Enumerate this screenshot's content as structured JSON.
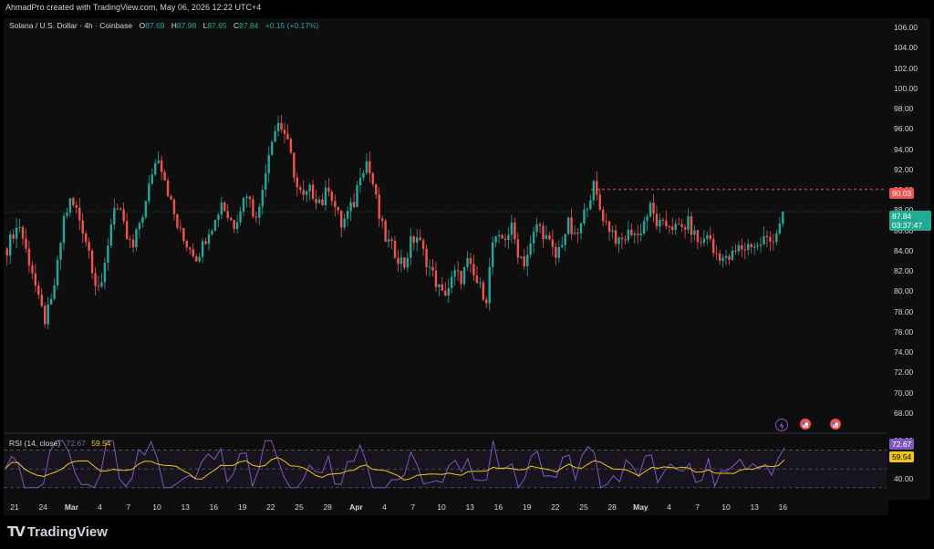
{
  "credit": "AhmadPro created with TradingView.com, May 06, 2026 12:22 UTC+4",
  "legend": {
    "symbol": "Solana / U.S. Dollar · 4h · Coinbase",
    "o_label": "O",
    "o_value": "87.69",
    "h_label": "H",
    "h_value": "87.98",
    "l_label": "L",
    "l_value": "87.65",
    "c_label": "C",
    "c_value": "87.84",
    "change": "+0.15 (+0.17%)"
  },
  "rsi_legend": {
    "label": "RSI (14, close)",
    "rsi": "72.67",
    "ma": "59.54"
  },
  "tags": {
    "level": "90.03",
    "price": "87.84",
    "countdown": "03:37:47",
    "rsi": "72.67",
    "rsi_ma": "59.54"
  },
  "brand": {
    "text": "TradingView",
    "mark": "TV"
  },
  "colors": {
    "up": "#26a69a",
    "down": "#ef5350",
    "rsi": "#7e57c2",
    "rsi_ma": "#f0c419",
    "level": "#ef5350",
    "bg": "#0e0e0e"
  },
  "icons": [
    "lightning-event-icon",
    "us-flag-event-icon",
    "us-flag-event-icon"
  ],
  "chart_data": {
    "type": "candlestick",
    "timeframe": "4h",
    "y_ticks": [
      "106.00",
      "104.00",
      "102.00",
      "100.00",
      "98.00",
      "96.00",
      "94.00",
      "92.00",
      "90.00",
      "88.00",
      "86.00",
      "84.00",
      "82.00",
      "80.00",
      "78.00",
      "76.00",
      "74.00",
      "72.00",
      "70.00",
      "68.00"
    ],
    "ylim": [
      67,
      106
    ],
    "x_ticks": [
      {
        "label": "21"
      },
      {
        "label": "24"
      },
      {
        "label": "Mar",
        "bold": true
      },
      {
        "label": "4"
      },
      {
        "label": "7"
      },
      {
        "label": "10"
      },
      {
        "label": "13"
      },
      {
        "label": "16"
      },
      {
        "label": "19"
      },
      {
        "label": "22"
      },
      {
        "label": "25"
      },
      {
        "label": "28"
      },
      {
        "label": "Apr",
        "bold": true
      },
      {
        "label": "4"
      },
      {
        "label": "7"
      },
      {
        "label": "10"
      },
      {
        "label": "13"
      },
      {
        "label": "16"
      },
      {
        "label": "19"
      },
      {
        "label": "22"
      },
      {
        "label": "25"
      },
      {
        "label": "28"
      },
      {
        "label": "May",
        "bold": true
      },
      {
        "label": "4"
      },
      {
        "label": "7"
      },
      {
        "label": "10"
      },
      {
        "label": "13"
      },
      {
        "label": "16"
      }
    ],
    "horizontal_level": 90.03,
    "last_price": 87.84,
    "closes": [
      84.2,
      85.8,
      86.5,
      84.0,
      82.0,
      79.0,
      77.2,
      78.8,
      82.5,
      87.2,
      88.8,
      88.0,
      86.2,
      84.0,
      81.0,
      80.2,
      84.8,
      88.6,
      87.4,
      85.2,
      84.2,
      86.8,
      88.6,
      91.8,
      93.4,
      91.2,
      88.6,
      86.4,
      85.0,
      84.4,
      83.4,
      84.5,
      86.2,
      86.9,
      88.9,
      87.4,
      86.6,
      88.3,
      89.8,
      87.8,
      88.0,
      92.2,
      95.3,
      96.6,
      95.6,
      93.2,
      90.2,
      89.1,
      89.9,
      89.3,
      88.8,
      90.4,
      88.3,
      86.5,
      87.6,
      88.7,
      91.8,
      92.8,
      90.6,
      87.3,
      85.2,
      84.3,
      83.4,
      82.6,
      84.8,
      85.4,
      83.8,
      82.3,
      80.9,
      79.6,
      80.4,
      81.7,
      81.3,
      82.8,
      81.4,
      80.3,
      79.4,
      84.8,
      84.9,
      85.4,
      86.2,
      83.9,
      82.9,
      84.4,
      86.6,
      85.8,
      84.6,
      83.3,
      85.0,
      86.6,
      85.1,
      86.4,
      88.8,
      90.3,
      88.1,
      86.7,
      85.9,
      84.6,
      85.3,
      86.0,
      85.4,
      86.9,
      88.2,
      86.7,
      86.3,
      86.7,
      86.2,
      86.2,
      86.7,
      85.5,
      84.6,
      85.8,
      83.8,
      83.6,
      83.0,
      83.5,
      84.2,
      84.3,
      84.7,
      84.3,
      85.2,
      84.9,
      85.9,
      87.84
    ],
    "rsi_ylim": [
      25,
      85
    ],
    "rsi_ticks": [
      "80.00",
      "40.00"
    ],
    "rsi_last": 72.67,
    "rsi_ma_last": 59.54
  }
}
